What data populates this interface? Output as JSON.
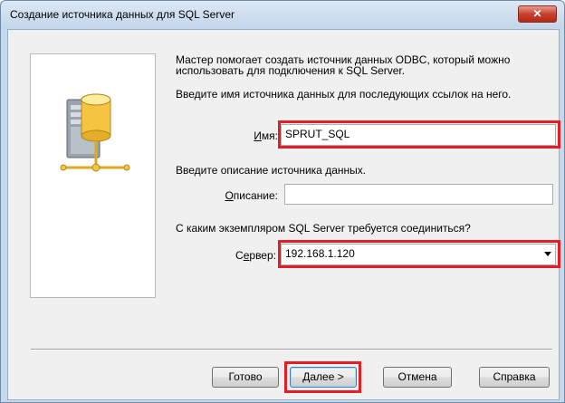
{
  "window": {
    "title": "Создание источника данных для SQL Server",
    "close_label": "✕"
  },
  "intro": {
    "line1": "Мастер помогает создать источник данных ODBC, который можно",
    "line2": "использовать для подключения к SQL Server.",
    "line3": "Введите имя источника данных для последующих ссылок на него."
  },
  "name_field": {
    "label_u": "И",
    "label_rest": "мя:",
    "value": "SPRUT_SQL"
  },
  "description_prompt": "Введите описание источника данных.",
  "description_field": {
    "label_u": "О",
    "label_rest": "писание:",
    "value": ""
  },
  "server_prompt": "С каким экземпляром SQL Server требуется соединиться?",
  "server_field": {
    "label_pre": "С",
    "label_u": "е",
    "label_rest": "рвер:",
    "value": "192.168.1.120"
  },
  "buttons": {
    "finish": "Готово",
    "next_u": "Д",
    "next_rest": "алее >",
    "cancel": "Отмена",
    "help": "Справка"
  },
  "colors": {
    "highlight": "#e31e24",
    "server_icon_primary": "#f5c542"
  },
  "icons": [
    "server-database-icon",
    "network-icon",
    "dropdown-arrow-icon",
    "close-icon"
  ]
}
